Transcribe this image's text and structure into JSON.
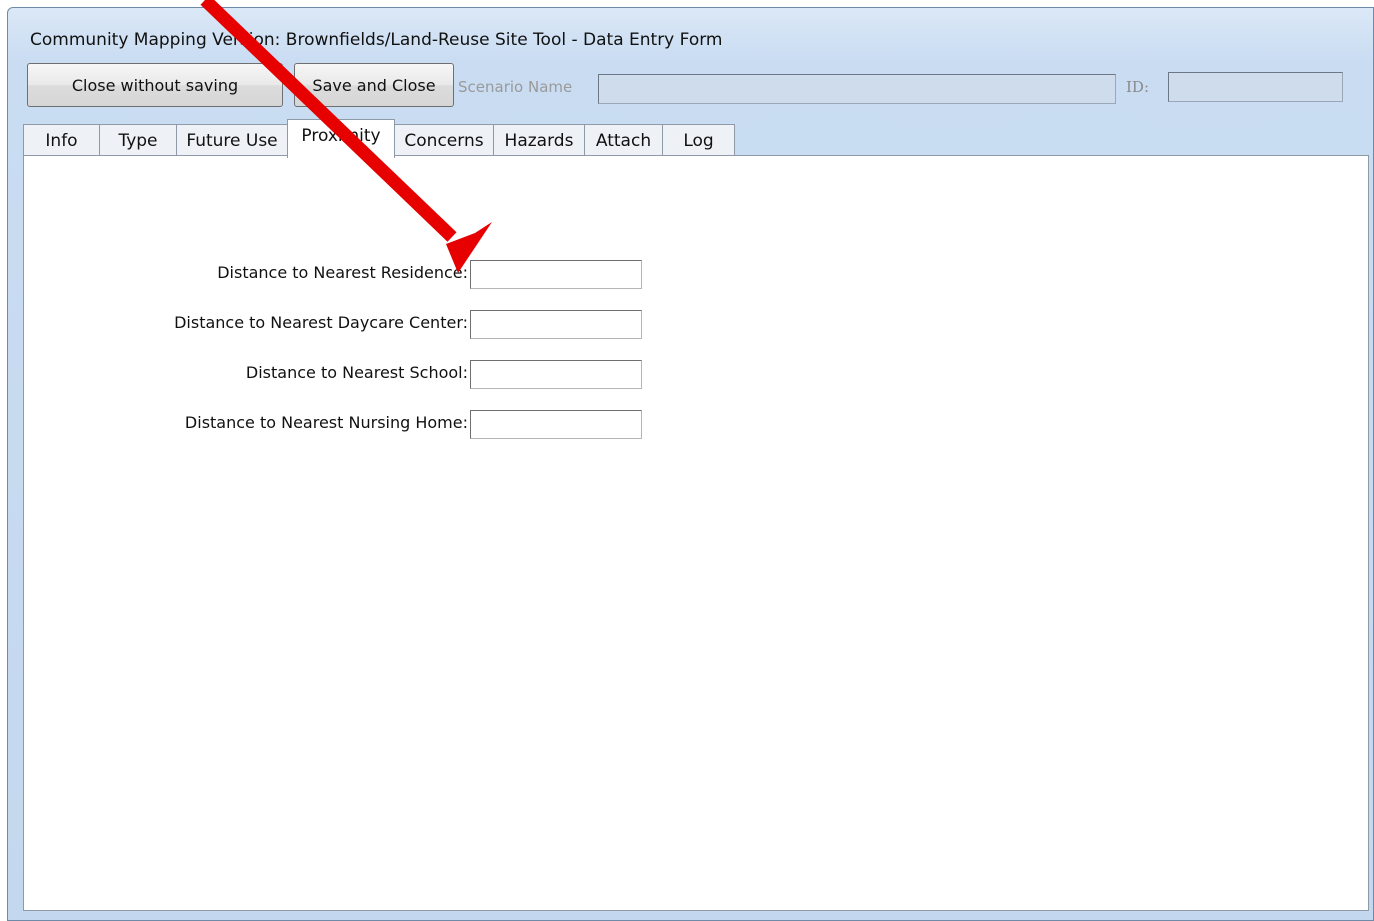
{
  "window": {
    "title": "Community Mapping Version: Brownfields/Land-Reuse Site Tool - Data Entry Form"
  },
  "toolbar": {
    "close_without_saving_label": "Close without saving",
    "save_and_close_label": "Save and Close",
    "scenario_name_label": "Scenario Name",
    "scenario_name_value": "",
    "id_label": "ID:",
    "id_value": ""
  },
  "tabs": [
    {
      "label": "Info",
      "active": false
    },
    {
      "label": "Type",
      "active": false
    },
    {
      "label": "Future Use",
      "active": false
    },
    {
      "label": "Proximity",
      "active": true
    },
    {
      "label": "Concerns",
      "active": false
    },
    {
      "label": "Hazards",
      "active": false
    },
    {
      "label": "Attach",
      "active": false
    },
    {
      "label": "Log",
      "active": false
    }
  ],
  "proximity": {
    "fields": [
      {
        "label": "Distance to Nearest Residence:",
        "value": ""
      },
      {
        "label": "Distance to Nearest Daycare Center:",
        "value": ""
      },
      {
        "label": "Distance to Nearest School:",
        "value": ""
      },
      {
        "label": "Distance to Nearest Nursing Home:",
        "value": ""
      }
    ]
  },
  "annotation": {
    "arrow_color": "#e60000"
  }
}
